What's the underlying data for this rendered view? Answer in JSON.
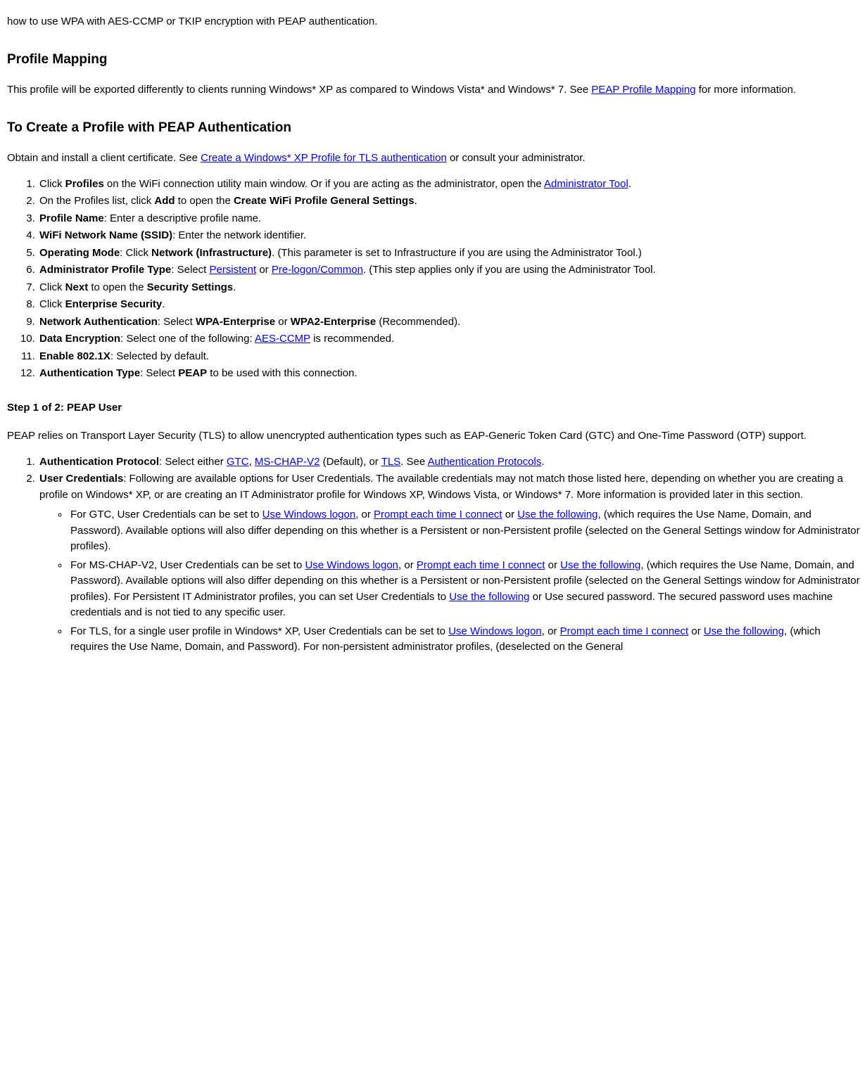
{
  "intro_fragment": "how to use WPA with AES-CCMP or TKIP encryption with PEAP authentication.",
  "profile_mapping": {
    "title": "Profile Mapping",
    "p1_a": "This profile will be exported differently to clients running Windows* XP as compared to Windows Vista* and Windows* 7. See ",
    "p1_link": "PEAP Profile Mapping",
    "p1_b": " for more information."
  },
  "create_profile": {
    "title": "To Create a Profile with PEAP Authentication",
    "p1_a": "Obtain and install a client certificate. See ",
    "p1_link": "Create a Windows* XP Profile for TLS authentication",
    "p1_b": " or consult your administrator.",
    "li1_a": "Click ",
    "li1_b": "Profiles",
    "li1_c": " on the WiFi connection utility main window. Or if you are acting as the administrator, open the ",
    "li1_link": "Administrator Tool",
    "li1_d": ".",
    "li2_a": "On the Profiles list, click ",
    "li2_b": "Add",
    "li2_c": " to open the ",
    "li2_d": "Create WiFi Profile General Settings",
    "li2_e": ".",
    "li3_a": "Profile Name",
    "li3_b": ": Enter a descriptive profile name.",
    "li4_a": "WiFi Network Name (SSID)",
    "li4_b": ": Enter the network identifier.",
    "li5_a": "Operating Mode",
    "li5_b": ": Click ",
    "li5_c": "Network (Infrastructure)",
    "li5_d": ". (This parameter is set to Infrastructure if you are using the Administrator Tool.)",
    "li6_a": "Administrator Profile Type",
    "li6_b": ": Select ",
    "li6_link1": "Persistent",
    "li6_c": " or ",
    "li6_link2": "Pre-logon/Common",
    "li6_d": ". (This step applies only if you are using the Administrator Tool.",
    "li7_a": "Click ",
    "li7_b": "Next",
    "li7_c": " to open the ",
    "li7_d": "Security Settings",
    "li7_e": ".",
    "li8_a": "Click ",
    "li8_b": "Enterprise Security",
    "li8_c": ".",
    "li9_a": "Network Authentication",
    "li9_b": ": Select ",
    "li9_c": "WPA-Enterprise",
    "li9_d": " or ",
    "li9_e": "WPA2-Enterprise",
    "li9_f": " (Recommended).",
    "li10_a": "Data Encryption",
    "li10_b": ": Select one of the following: ",
    "li10_link": "AES-CCMP",
    "li10_c": " is recommended.",
    "li11_a": "Enable 802.1X",
    "li11_b": ": Selected by default.",
    "li12_a": "Authentication Type",
    "li12_b": ": Select ",
    "li12_c": "PEAP",
    "li12_d": " to be used with this connection."
  },
  "step1": {
    "title": "Step 1 of 2: PEAP User",
    "p1": "PEAP relies on Transport Layer Security (TLS) to allow unencrypted authentication types such as EAP-Generic Token Card (GTC) and One-Time Password (OTP) support.",
    "li1_a": "Authentication Protocol",
    "li1_b": ": Select either ",
    "li1_link1": "GTC",
    "li1_c": ", ",
    "li1_link2": "MS-CHAP-V2",
    "li1_d": " (Default), or ",
    "li1_link3": "TLS",
    "li1_e": ". See ",
    "li1_link4": "Authentication Protocols",
    "li1_f": ".",
    "li2_a": "User Credentials",
    "li2_b": ": Following are available options for User Credentials. The available credentials may not match those listed here, depending on whether you are creating a profile on Windows* XP, or are creating an IT Administrator profile for Windows XP, Windows Vista, or Windows* 7. More information is provided later in this section.",
    "sub1_a": "For GTC, User Credentials can be set to ",
    "sub1_link1": "Use Windows logon",
    "sub1_b": ", or ",
    "sub1_link2": "Prompt each time I connect",
    "sub1_c": " or ",
    "sub1_link3": "Use the following",
    "sub1_d": ", (which requires the Use Name, Domain, and Password). Available options will also differ depending on this whether is a Persistent or non-Persistent profile (selected on the General Settings window for Administrator profiles).",
    "sub2_a": "For MS-CHAP-V2, User Credentials can be set to ",
    "sub2_link1": "Use Windows logon",
    "sub2_b": ", or ",
    "sub2_link2": "Prompt each time I connect",
    "sub2_c": " or ",
    "sub2_link3": "Use the following",
    "sub2_d": ", (which requires the Use Name, Domain, and Password). Available options will also differ depending on this whether is a Persistent or non-Persistent profile (selected on the General Settings window for Administrator profiles). For Persistent IT Administrator profiles, you can set User Credentials to ",
    "sub2_link4": "Use the following",
    "sub2_e": " or Use secured password. The secured password uses machine credentials and is not tied to any specific user.",
    "sub3_a": "For TLS, for a single user profile in Windows* XP, User Credentials can be set to ",
    "sub3_link1": "Use Windows logon",
    "sub3_b": ", or ",
    "sub3_link2": "Prompt each time I connect",
    "sub3_c": " or ",
    "sub3_link3": "Use the following",
    "sub3_d": ", (which requires the Use Name, Domain, and Password). For non-persistent administrator profiles, (deselected on the General"
  }
}
